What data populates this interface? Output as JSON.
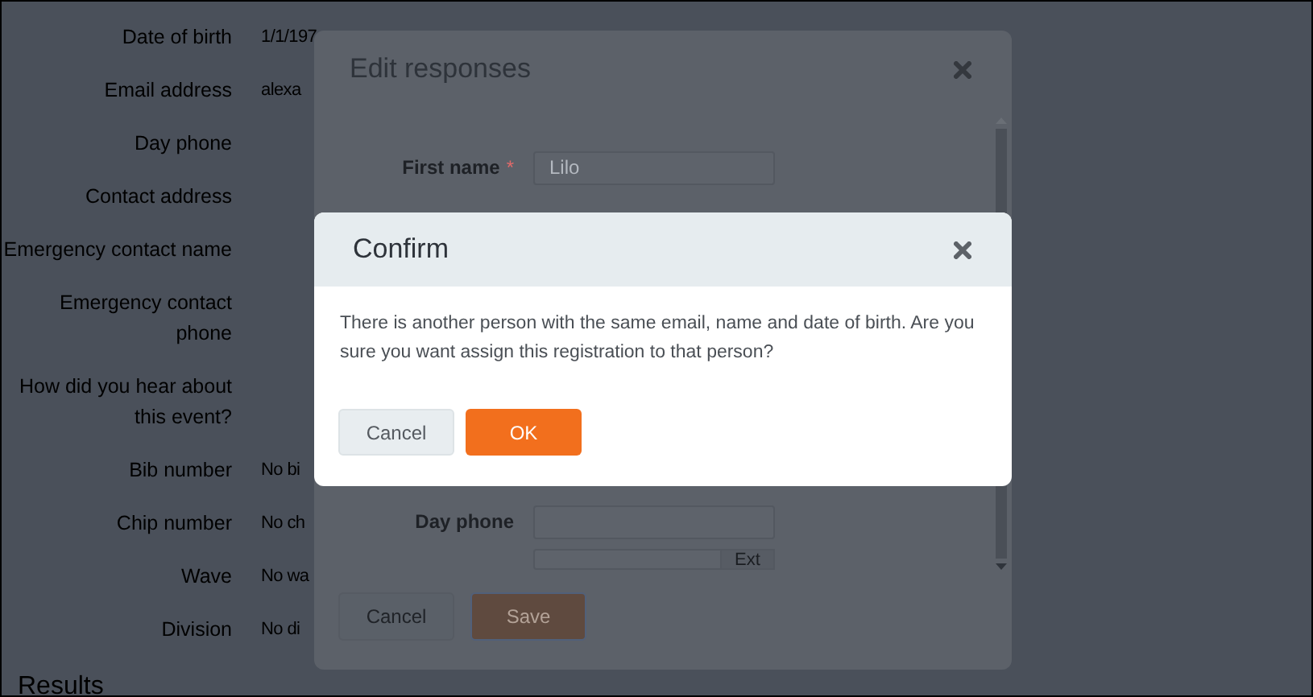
{
  "background": {
    "fields": [
      {
        "label": "Date of birth",
        "value": "1/1/197"
      },
      {
        "label": "Email address",
        "value": "alexa"
      },
      {
        "label": "Day phone"
      },
      {
        "label": "Contact address"
      },
      {
        "label": "Emergency contact name"
      },
      {
        "label": "Emergency contact phone"
      },
      {
        "label": "How did you hear about this event?"
      },
      {
        "label": "Bib number",
        "value": "No bi"
      },
      {
        "label": "Chip number",
        "value": "No ch"
      },
      {
        "label": "Wave",
        "value": "No wa"
      },
      {
        "label": "Division",
        "value": "No di"
      }
    ],
    "section_heading": "Results"
  },
  "edit_dialog": {
    "title": "Edit responses",
    "fields": [
      {
        "label": "First name",
        "required_mark": "*",
        "value": "Lilo"
      },
      {
        "label": "Day phone"
      }
    ],
    "ext_addon": "Ext",
    "buttons": [
      {
        "label": "Cancel",
        "kind": "secondary"
      },
      {
        "label": "Save",
        "kind": "primary"
      }
    ]
  },
  "confirm_dialog": {
    "title": "Confirm",
    "message": "There is another person with the same email, name and date of birth. Are you sure you want assign this registration to that person?",
    "buttons": [
      {
        "label": "Cancel",
        "kind": "secondary"
      },
      {
        "label": "OK",
        "kind": "primary"
      }
    ]
  }
}
